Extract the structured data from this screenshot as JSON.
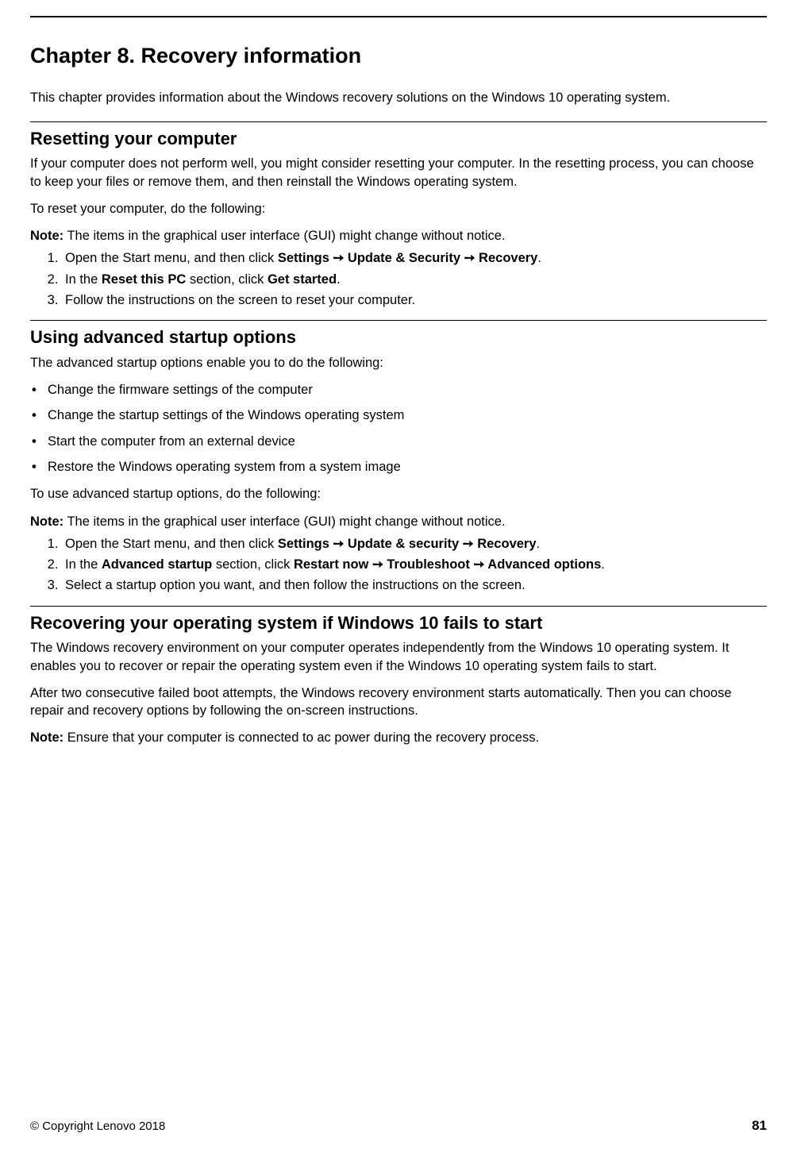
{
  "chapter_title": "Chapter 8.   Recovery information",
  "intro": "This chapter provides information about the Windows recovery solutions on the Windows 10 operating system.",
  "sec1": {
    "heading": "Resetting your computer",
    "para1": "If your computer does not perform well, you might consider resetting your computer. In the resetting process, you can choose to keep your files or remove them, and then reinstall the Windows operating system.",
    "para2": "To reset your computer, do the following:",
    "note_label": "Note:",
    "note_text": "  The items in the graphical user interface (GUI) might change without notice.",
    "step1_a": "Open the Start menu, and then click ",
    "step1_settings": "Settings",
    "step1_arrow1": " ➙ ",
    "step1_update": "Update & Security",
    "step1_arrow2": " ➙ ",
    "step1_recovery": "Recovery",
    "step1_dot": ".",
    "step2_a": "In the ",
    "step2_reset": "Reset this PC",
    "step2_b": " section, click ",
    "step2_get": "Get started",
    "step2_dot": ".",
    "step3": "Follow the instructions on the screen to reset your computer."
  },
  "sec2": {
    "heading": "Using advanced startup options",
    "para1": "The advanced startup options enable you to do the following:",
    "bullets": [
      "Change the firmware settings of the computer",
      "Change the startup settings of the Windows operating system",
      "Start the computer from an external device",
      "Restore the Windows operating system from a system image"
    ],
    "para2": "To use advanced startup options, do the following:",
    "note_label": "Note:",
    "note_text": "  The items in the graphical user interface (GUI) might change without notice.",
    "step1_a": "Open the Start menu, and then click ",
    "step1_settings": "Settings",
    "step1_arrow1": " ➙ ",
    "step1_update": "Update & security",
    "step1_arrow2": " ➙ ",
    "step1_recovery": "Recovery",
    "step1_dot": ".",
    "step2_a": "In the ",
    "step2_adv": "Advanced startup",
    "step2_b": " section, click ",
    "step2_restart": "Restart now",
    "step2_arrow1": " ➙ ",
    "step2_trouble": "Troubleshoot",
    "step2_arrow2": " ➙ ",
    "step2_options": "Advanced options",
    "step2_dot": ".",
    "step3": "Select a startup option you want, and then follow the instructions on the screen."
  },
  "sec3": {
    "heading": "Recovering your operating system if Windows 10 fails to start",
    "para1": "The Windows recovery environment on your computer operates independently from the Windows 10 operating system. It enables you to recover or repair the operating system even if the Windows 10 operating system fails to start.",
    "para2": "After two consecutive failed boot attempts, the Windows recovery environment starts automatically. Then you can choose repair and recovery options by following the on-screen instructions.",
    "note_label": "Note:",
    "note_text": "  Ensure that your computer is connected to ac power during the recovery process."
  },
  "footer": {
    "copyright": "© Copyright Lenovo 2018",
    "page": "81"
  }
}
